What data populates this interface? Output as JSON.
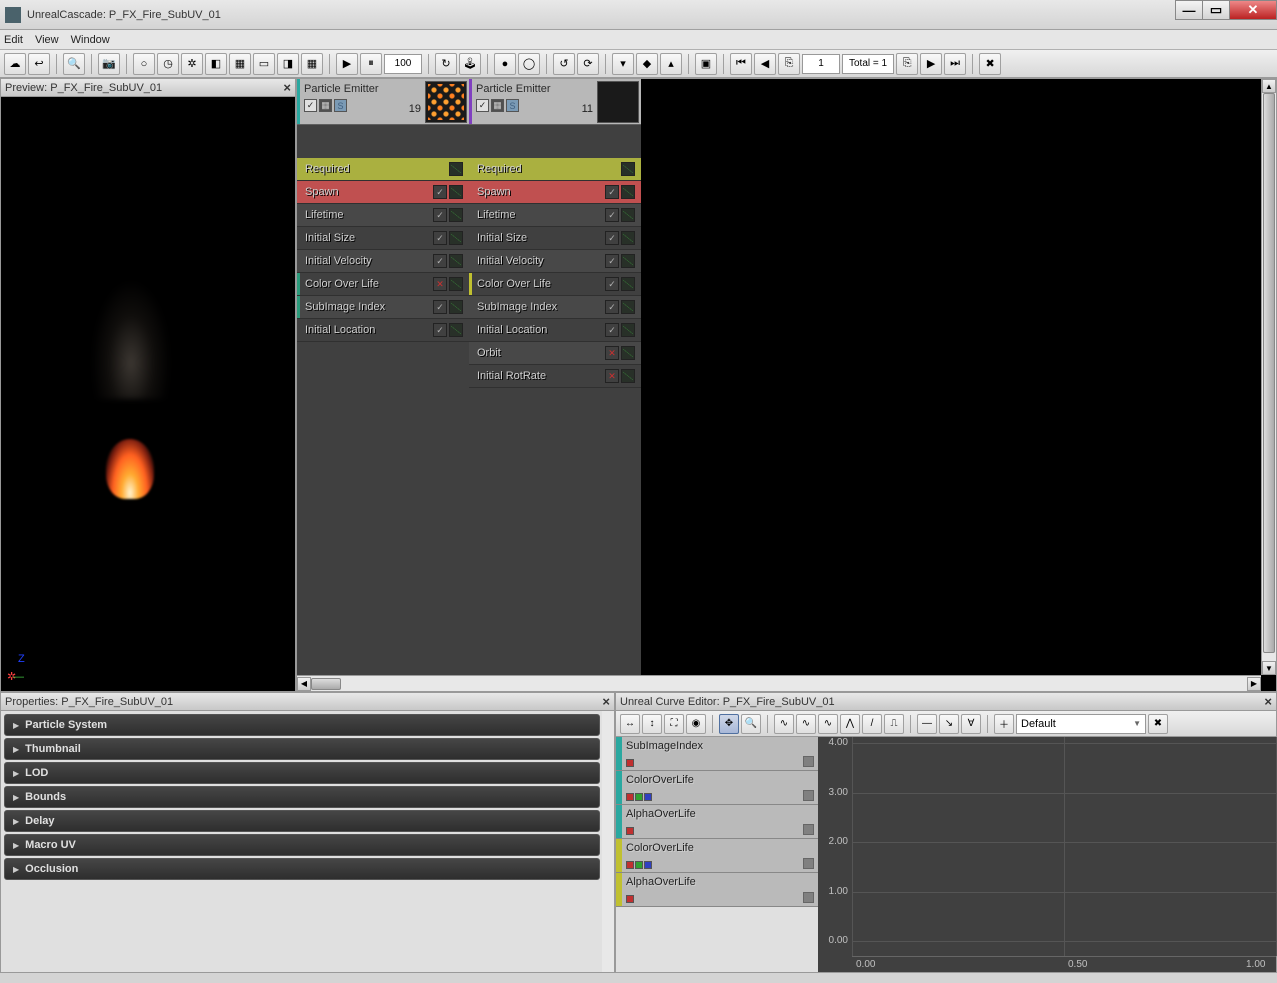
{
  "window": {
    "title": "UnrealCascade: P_FX_Fire_SubUV_01",
    "min": "—",
    "max": "▭",
    "close": "✕"
  },
  "menu": [
    "Edit",
    "View",
    "Window"
  ],
  "toolbar": {
    "sim_speed": "100",
    "lod_value": "1",
    "total_text": "Total = 1"
  },
  "preview": {
    "title": "Preview: P_FX_Fire_SubUV_01",
    "axis_z": "Z"
  },
  "emitters": [
    {
      "name": "Particle Emitter",
      "count": "19",
      "accent": "#2aa8a0",
      "thumb": "fire",
      "modules": [
        {
          "label": "Required",
          "class": "mr-required",
          "chk": "none",
          "accent": ""
        },
        {
          "label": "Spawn",
          "class": "mr-spawn",
          "chk": "on",
          "accent": ""
        },
        {
          "label": "Lifetime",
          "class": "mr-normal",
          "chk": "on",
          "accent": ""
        },
        {
          "label": "Initial Size",
          "class": "mr-normal",
          "chk": "on",
          "accent": ""
        },
        {
          "label": "Initial Velocity",
          "class": "mr-normal",
          "chk": "on",
          "accent": ""
        },
        {
          "label": "Color Over Life",
          "class": "mr-normal",
          "chk": "off",
          "accent": "#2a9a7a"
        },
        {
          "label": "SubImage Index",
          "class": "mr-normal",
          "chk": "on",
          "accent": "#2a9a7a"
        },
        {
          "label": "Initial Location",
          "class": "mr-normal",
          "chk": "on",
          "accent": ""
        }
      ]
    },
    {
      "name": "Particle Emitter",
      "count": "11",
      "accent": "#8040c0",
      "thumb": "dark",
      "modules": [
        {
          "label": "Required",
          "class": "mr-required",
          "chk": "none",
          "accent": ""
        },
        {
          "label": "Spawn",
          "class": "mr-spawn",
          "chk": "on",
          "accent": ""
        },
        {
          "label": "Lifetime",
          "class": "mr-normal",
          "chk": "on",
          "accent": ""
        },
        {
          "label": "Initial Size",
          "class": "mr-normal",
          "chk": "on",
          "accent": ""
        },
        {
          "label": "Initial Velocity",
          "class": "mr-normal",
          "chk": "on",
          "accent": ""
        },
        {
          "label": "Color Over Life",
          "class": "mr-normal",
          "chk": "on",
          "accent": "#c0c030"
        },
        {
          "label": "SubImage Index",
          "class": "mr-normal",
          "chk": "on",
          "accent": ""
        },
        {
          "label": "Initial Location",
          "class": "mr-normal",
          "chk": "on",
          "accent": ""
        },
        {
          "label": "Orbit",
          "class": "mr-normal",
          "chk": "off",
          "accent": ""
        },
        {
          "label": "Initial RotRate",
          "class": "mr-normal",
          "chk": "off",
          "accent": ""
        }
      ]
    }
  ],
  "properties": {
    "title": "Properties: P_FX_Fire_SubUV_01",
    "groups": [
      "Particle System",
      "Thumbnail",
      "LOD",
      "Bounds",
      "Delay",
      "Macro UV",
      "Occlusion"
    ]
  },
  "curve_editor": {
    "title": "Unreal Curve Editor: P_FX_Fire_SubUV_01",
    "tab_label": "Default",
    "items": [
      {
        "name": "SubImageIndex",
        "accent": "#2aa8a0",
        "swatches": [
          "#c03030"
        ]
      },
      {
        "name": "ColorOverLife",
        "accent": "#2aa8a0",
        "swatches": [
          "#c03030",
          "#30a030",
          "#3040c0"
        ]
      },
      {
        "name": "AlphaOverLife",
        "accent": "#2aa8a0",
        "swatches": [
          "#c03030"
        ]
      },
      {
        "name": "ColorOverLife",
        "accent": "#c0c030",
        "swatches": [
          "#c03030",
          "#30a030",
          "#3040c0"
        ]
      },
      {
        "name": "AlphaOverLife",
        "accent": "#c0c030",
        "swatches": [
          "#c03030"
        ]
      }
    ],
    "y_ticks": [
      "4.00",
      "3.00",
      "2.00",
      "1.00",
      "0.00"
    ],
    "x_ticks": [
      "0.00",
      "0.50",
      "1.00"
    ]
  }
}
